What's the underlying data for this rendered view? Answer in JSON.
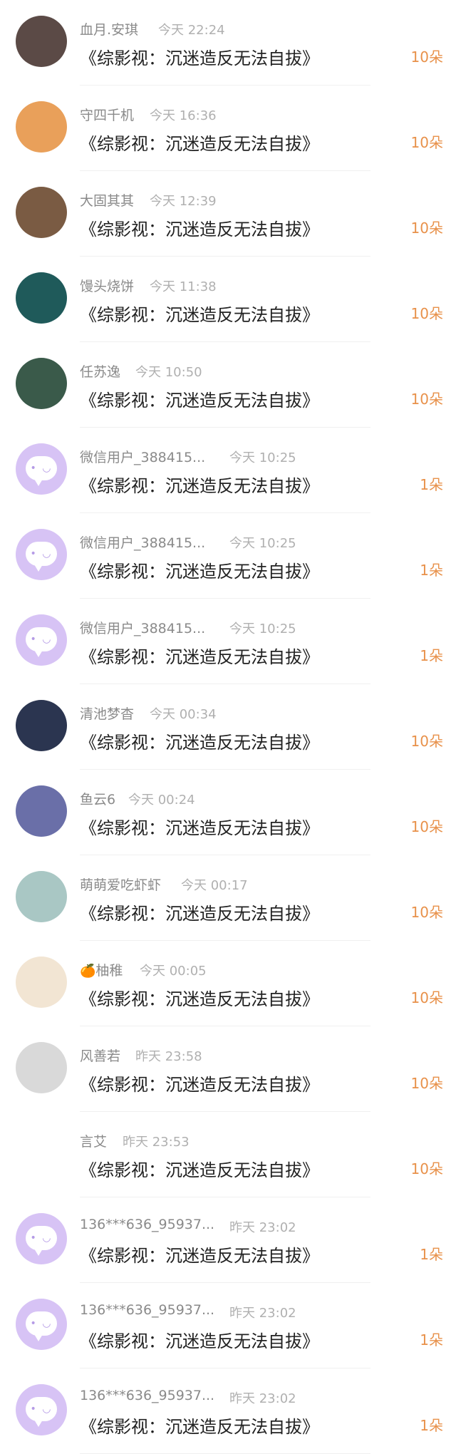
{
  "items": [
    {
      "name": "血月.安琪",
      "time": "今天 22:24",
      "title": "《综影视：沉迷造反无法自拔》",
      "amount": "10朵",
      "avatar": "photo",
      "avatar_color": "#5b4a46"
    },
    {
      "name": "守四千机",
      "time": "今天 16:36",
      "title": "《综影视：沉迷造反无法自拔》",
      "amount": "10朵",
      "avatar": "photo",
      "avatar_color": "#e9a05a"
    },
    {
      "name": "大固其其",
      "time": "今天 12:39",
      "title": "《综影视：沉迷造反无法自拔》",
      "amount": "10朵",
      "avatar": "photo",
      "avatar_color": "#7a5b43"
    },
    {
      "name": "馒头烧饼",
      "time": "今天 11:38",
      "title": "《综影视：沉迷造反无法自拔》",
      "amount": "10朵",
      "avatar": "photo",
      "avatar_color": "#1f5a5a"
    },
    {
      "name": "任苏逸",
      "time": "今天 10:50",
      "title": "《综影视：沉迷造反无法自拔》",
      "amount": "10朵",
      "avatar": "photo",
      "avatar_color": "#3a5a4a"
    },
    {
      "name": "微信用户_388415...",
      "time": "今天 10:25",
      "title": "《综影视：沉迷造反无法自拔》",
      "amount": "1朵",
      "avatar": "default",
      "avatar_color": "#d7c3f5"
    },
    {
      "name": "微信用户_388415...",
      "time": "今天 10:25",
      "title": "《综影视：沉迷造反无法自拔》",
      "amount": "1朵",
      "avatar": "default",
      "avatar_color": "#d7c3f5"
    },
    {
      "name": "微信用户_388415...",
      "time": "今天 10:25",
      "title": "《综影视：沉迷造反无法自拔》",
      "amount": "1朵",
      "avatar": "default",
      "avatar_color": "#d7c3f5"
    },
    {
      "name": "清池梦杳",
      "time": "今天 00:34",
      "title": "《综影视：沉迷造反无法自拔》",
      "amount": "10朵",
      "avatar": "photo",
      "avatar_color": "#2b3550"
    },
    {
      "name": "鱼云6",
      "time": "今天 00:24",
      "title": "《综影视：沉迷造反无法自拔》",
      "amount": "10朵",
      "avatar": "photo",
      "avatar_color": "#6a6fa8"
    },
    {
      "name": "萌萌爱吃虾虾",
      "time": "今天 00:17",
      "title": "《综影视：沉迷造反无法自拔》",
      "amount": "10朵",
      "avatar": "photo",
      "avatar_color": "#a9c7c4"
    },
    {
      "name": "柚稚",
      "emoji": "🍊",
      "time": "今天 00:05",
      "title": "《综影视：沉迷造反无法自拔》",
      "amount": "10朵",
      "avatar": "photo",
      "avatar_color": "#f2e5d3"
    },
    {
      "name": "风善若",
      "time": "昨天 23:58",
      "title": "《综影视：沉迷造反无法自拔》",
      "amount": "10朵",
      "avatar": "photo",
      "avatar_color": "#d9d9d9"
    },
    {
      "name": "言艾",
      "time": "昨天 23:53",
      "title": "《综影视：沉迷造反无法自拔》",
      "amount": "10朵",
      "avatar": "photo",
      "avatar_color": "#ffffff"
    },
    {
      "name": "136***636_95937...",
      "time": "昨天 23:02",
      "title": "《综影视：沉迷造反无法自拔》",
      "amount": "1朵",
      "avatar": "default",
      "avatar_color": "#d7c3f5"
    },
    {
      "name": "136***636_95937...",
      "time": "昨天 23:02",
      "title": "《综影视：沉迷造反无法自拔》",
      "amount": "1朵",
      "avatar": "default",
      "avatar_color": "#d7c3f5"
    },
    {
      "name": "136***636_95937...",
      "time": "昨天 23:02",
      "title": "《综影视：沉迷造反无法自拔》",
      "amount": "1朵",
      "avatar": "default",
      "avatar_color": "#d7c3f5"
    }
  ],
  "colors": {
    "amount": "#e8914a",
    "default_avatar": "#d7c3f5"
  }
}
